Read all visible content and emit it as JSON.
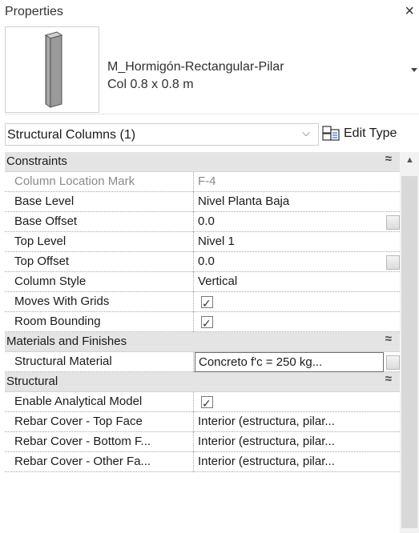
{
  "window": {
    "title": "Properties",
    "close_glyph": "×"
  },
  "type_selector": {
    "family": "M_Hormigón-Rectangular-Pilar",
    "type": "Col 0.8 x 0.8 m",
    "thumbnail_icon": "concrete-column-icon"
  },
  "instance_filter": {
    "label": "Structural Columns (1)",
    "chevron": "⌵"
  },
  "edit_type": {
    "label": "Edit Type",
    "icon": "edit-type-icon"
  },
  "grid": {
    "sections": [
      {
        "title": "Constraints",
        "collapse_glyph": "≈",
        "rows": [
          {
            "label": "Column Location Mark",
            "value": "F-4",
            "disabled": true
          },
          {
            "label": "Base Level",
            "value": "Nivel Planta Baja"
          },
          {
            "label": "Base Offset",
            "value": "0.0",
            "button": true
          },
          {
            "label": "Top Level",
            "value": "Nivel 1"
          },
          {
            "label": "Top Offset",
            "value": "0.0",
            "button": true
          },
          {
            "label": "Column Style",
            "value": "Vertical"
          },
          {
            "label": "Moves With Grids",
            "checkbox": true
          },
          {
            "label": "Room Bounding",
            "checkbox": true
          }
        ]
      },
      {
        "title": "Materials and Finishes",
        "collapse_glyph": "≈",
        "rows": [
          {
            "label": "Structural Material",
            "value": "Concreto f'c = 250 kg...",
            "editing": true,
            "button": true
          }
        ]
      },
      {
        "title": "Structural",
        "collapse_glyph": "≈",
        "rows": [
          {
            "label": "Enable Analytical Model",
            "checkbox": true
          },
          {
            "label": "Rebar Cover - Top Face",
            "value": "Interior (estructura, pilar..."
          },
          {
            "label": "Rebar Cover - Bottom F...",
            "value": "Interior (estructura, pilar..."
          },
          {
            "label": "Rebar Cover - Other Fa...",
            "value": "Interior (estructura, pilar..."
          }
        ]
      }
    ]
  },
  "checkbox_glyph": "✓",
  "scroll_up_glyph": "▲"
}
